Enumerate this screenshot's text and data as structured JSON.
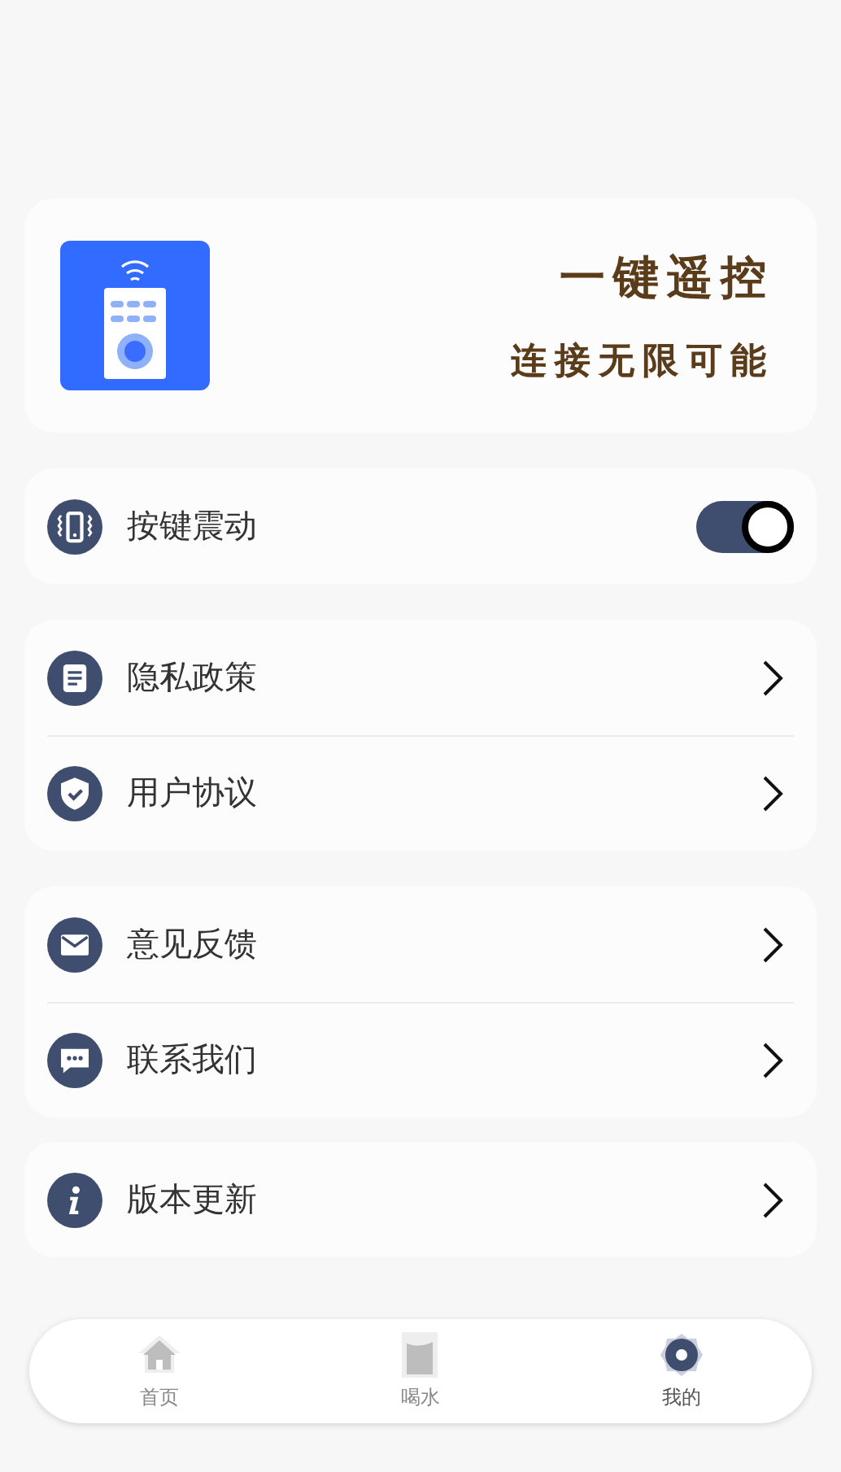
{
  "banner": {
    "title": "一键遥控",
    "subtitle": "连接无限可能"
  },
  "groups": [
    {
      "items": [
        {
          "kind": "toggle",
          "label": "按键震动",
          "on": true
        }
      ]
    },
    {
      "items": [
        {
          "kind": "link",
          "label": "隐私政策"
        },
        {
          "kind": "link",
          "label": "用户协议"
        }
      ]
    },
    {
      "items": [
        {
          "kind": "link",
          "label": "意见反馈"
        },
        {
          "kind": "link",
          "label": "联系我们"
        }
      ]
    },
    {
      "items": [
        {
          "kind": "link",
          "label": "版本更新"
        }
      ]
    }
  ],
  "tabs": [
    {
      "label": "首页",
      "selected": false
    },
    {
      "label": "喝水",
      "selected": false
    },
    {
      "label": "我的",
      "selected": true
    }
  ]
}
